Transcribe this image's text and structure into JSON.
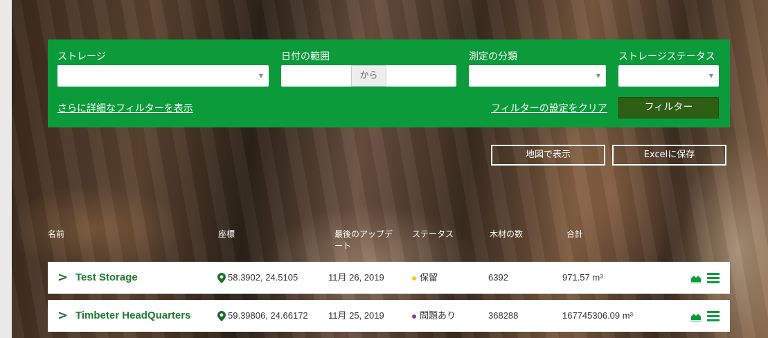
{
  "filters": {
    "storage_label": "ストレージ",
    "date_range_label": "日付の範囲",
    "date_separator": "から",
    "measurement_type_label": "測定の分類",
    "storage_status_label": "ストレージステータス",
    "more_filters_link": "さらに詳細なフィルターを表示",
    "clear_filters_link": "フィルターの設定をクリア",
    "filter_button": "フィルター"
  },
  "actions": {
    "show_on_map": "地図で表示",
    "save_excel": "Excelに保存"
  },
  "table": {
    "headers": {
      "name": "名前",
      "coordinates": "座標",
      "last_update": "最後のアップデート",
      "status": "ステータス",
      "timber_count": "木材の数",
      "total": "合計"
    },
    "rows": [
      {
        "name": "Test Storage",
        "coordinates": "58.3902, 24.5105",
        "date": "11月 26, 2019",
        "status": "保留",
        "status_color": "#f5c518",
        "count": "6392",
        "total": "971.57 m³"
      },
      {
        "name": "Timbeter HeadQuarters",
        "coordinates": "59.39806, 24.66172",
        "date": "11月 25, 2019",
        "status": "問題あり",
        "status_color": "#7a3f9e",
        "count": "368288",
        "total": "167745306.09 m³"
      }
    ]
  },
  "colors": {
    "brand_green": "#0b9b3a",
    "dark_green_button": "#2e5e14",
    "row_icon_green": "#0b9b3a"
  },
  "icons": [
    "chevron-right-icon",
    "map-pin-icon",
    "chart-icon",
    "menu-icon",
    "caret-down-icon"
  ]
}
